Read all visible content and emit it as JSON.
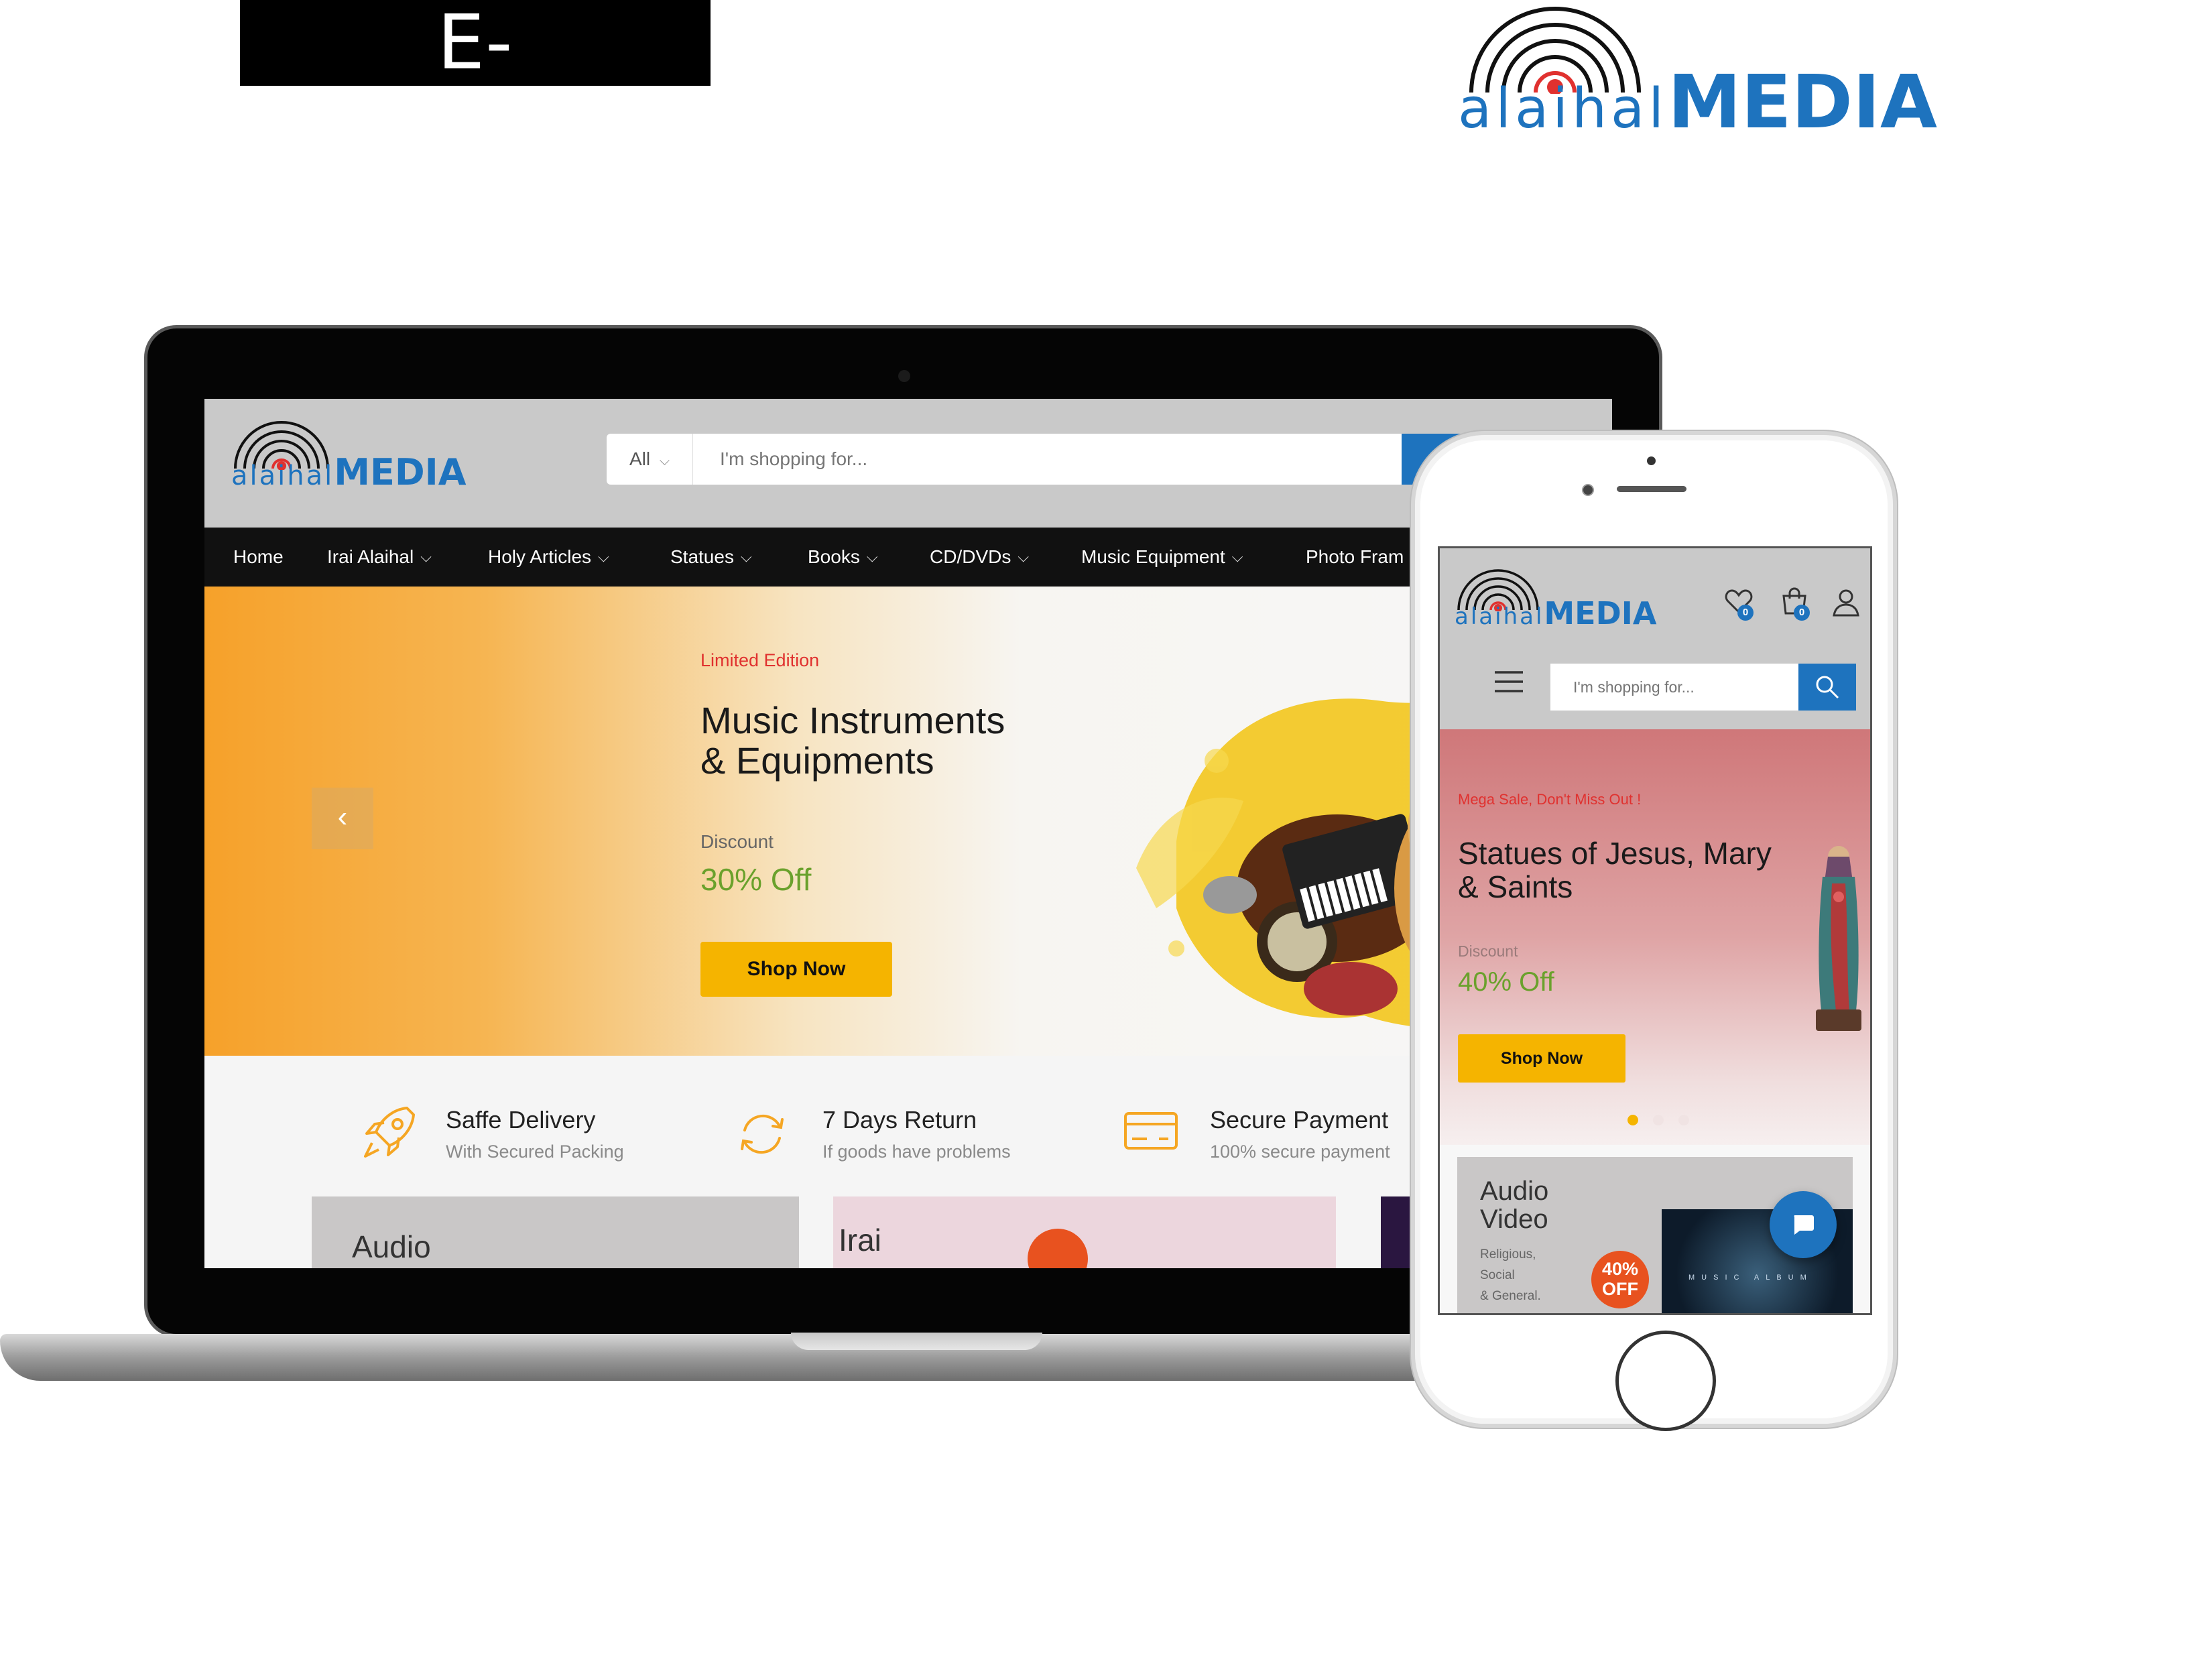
{
  "heading_tag": "E-Commerce",
  "brand": {
    "lower": "alaihal",
    "upper": "MEDIA"
  },
  "desktop": {
    "search": {
      "category": "All",
      "placeholder": "I'm shopping for..."
    },
    "nav": [
      {
        "label": "Home",
        "dropdown": false
      },
      {
        "label": "Irai Alaihal",
        "dropdown": true
      },
      {
        "label": "Holy Articles",
        "dropdown": true
      },
      {
        "label": "Statues",
        "dropdown": true
      },
      {
        "label": "Books",
        "dropdown": true
      },
      {
        "label": "CD/DVDs",
        "dropdown": true
      },
      {
        "label": "Music Equipment",
        "dropdown": true
      },
      {
        "label": "Photo Fram",
        "dropdown": false
      }
    ],
    "hero": {
      "kicker": "Limited Edition",
      "title_line1": "Music Instruments",
      "title_line2": "& Equipments",
      "discount_label": "Discount",
      "discount": "30% Off",
      "cta": "Shop Now"
    },
    "features": [
      {
        "title": "Saffe Delivery",
        "subtitle": "With Secured Packing",
        "icon": "rocket-icon"
      },
      {
        "title": "7 Days Return",
        "subtitle": "If goods have problems",
        "icon": "return-icon"
      },
      {
        "title": "Secure Payment",
        "subtitle": "100% secure payment",
        "icon": "card-icon"
      }
    ],
    "banners": [
      {
        "text": "Audio"
      },
      {
        "text": "Irai"
      }
    ]
  },
  "mobile": {
    "search": {
      "placeholder": "I'm shopping for..."
    },
    "wishlist_count": "0",
    "cart_count": "0",
    "hero": {
      "kicker": "Mega Sale, Don't Miss Out !",
      "title_line1": "Statues of Jesus, Mary",
      "title_line2": "& Saints",
      "discount_label": "Discount",
      "discount": "40% Off",
      "cta": "Shop Now",
      "active_slide": 1,
      "slide_count": 3
    },
    "card": {
      "title_line1": "Audio",
      "title_line2": "Video",
      "sub1": "Religious,",
      "sub2": "Social",
      "sub3": "& General.",
      "badge_line1": "40%",
      "badge_line2": "OFF",
      "album_text": "MUSIC ALBUM"
    }
  },
  "colors": {
    "brand_blue": "#1e73be",
    "cta_yellow": "#f5b400",
    "accent_red": "#e0312f",
    "discount_green": "#6aa12c"
  }
}
